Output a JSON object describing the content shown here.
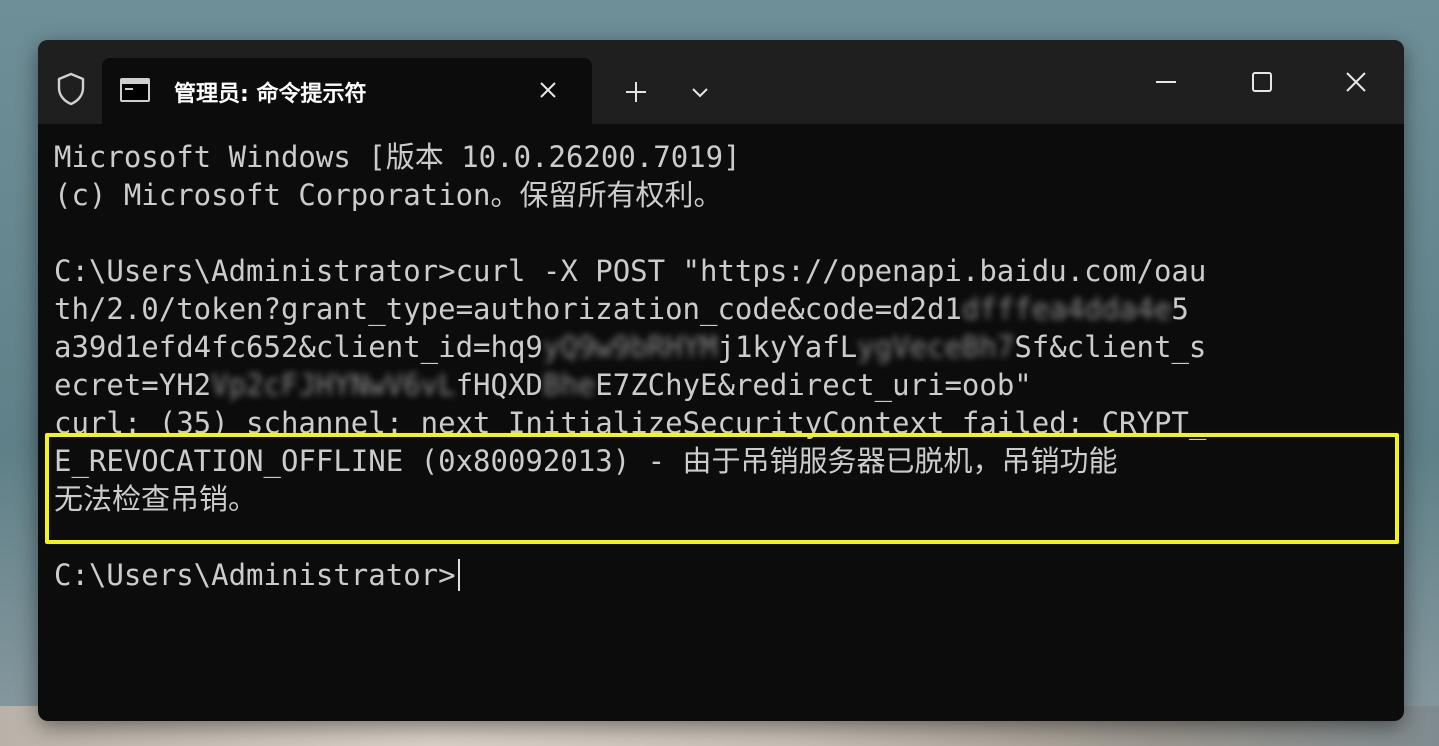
{
  "window": {
    "tab_title": "管理员: 命令提示符",
    "icons": {
      "shield": "shield-icon",
      "terminal": "terminal-icon",
      "close_tab": "close-icon",
      "new_tab": "plus-icon",
      "dropdown": "chevron-down-icon",
      "minimize": "minimize-icon",
      "maximize": "maximize-icon",
      "close": "close-icon"
    }
  },
  "terminal": {
    "lines": [
      {
        "text": "Microsoft Windows [版本 10.0.26200.7019]"
      },
      {
        "text": "(c) Microsoft Corporation。保留所有权利。"
      },
      {
        "text": ""
      },
      {
        "text": "C:\\Users\\Administrator>curl -X POST \"https://openapi.baidu.com/oau"
      },
      {
        "pre": "th/2.0/token?grant_type=authorization_code&code=d2d1",
        "blur": "dfffea4dda4e",
        "post": "5"
      },
      {
        "pre": "a39d1efd4fc652&client_id=hq9",
        "blur": "yQ9w9bRHYM",
        "mid": "j1kyYafL",
        "blur2": "ygVeceBh7",
        "post": "Sf&client_s"
      },
      {
        "pre": "ecret=YH2",
        "blur": "Vp2cFJHYNwV6vL",
        "mid": "fHQXD",
        "blur2": "Bhe",
        "post": "E7ZChyE&redirect_uri=oob\""
      },
      {
        "text": "curl: (35) schannel: next InitializeSecurityContext failed: CRYPT_"
      },
      {
        "text": "E_REVOCATION_OFFLINE (0x80092013) - 由于吊销服务器已脱机，吊销功能"
      },
      {
        "text": "无法检查吊销。"
      },
      {
        "text": ""
      },
      {
        "text": "C:\\Users\\Administrator>"
      }
    ]
  },
  "annotation": {
    "highlight_color": "#f4f416"
  },
  "colors": {
    "terminal_bg": "#0c0c0c",
    "titlebar_bg": "#1f1f1f",
    "text": "#cccccc"
  }
}
